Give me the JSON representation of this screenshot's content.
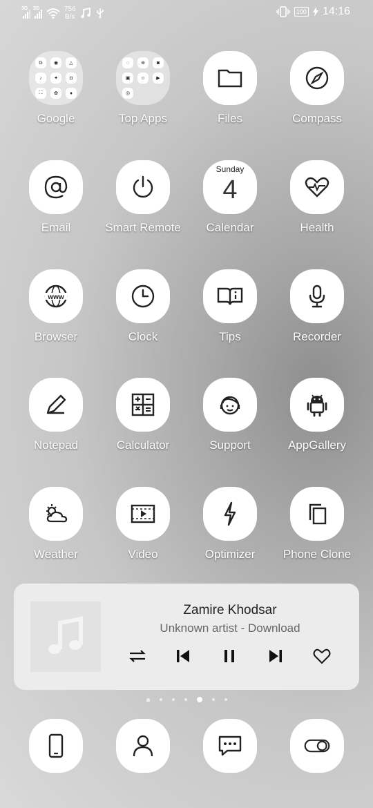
{
  "status_bar": {
    "net1": "3G",
    "net2": "3G",
    "speed_value": "756",
    "speed_unit": "B/s",
    "battery": "100",
    "time": "14:16",
    "icons": [
      "signal-icon",
      "signal-icon",
      "wifi-icon",
      "music-note-icon",
      "usb-icon",
      "vibrate-icon",
      "battery-icon",
      "charging-icon"
    ]
  },
  "apps": [
    {
      "label": "Google",
      "icon": "google-folder"
    },
    {
      "label": "Top Apps",
      "icon": "top-apps-folder"
    },
    {
      "label": "Files",
      "icon": "folder-icon"
    },
    {
      "label": "Compass",
      "icon": "compass-icon"
    },
    {
      "label": "Email",
      "icon": "at-sign-icon"
    },
    {
      "label": "Smart Remote",
      "icon": "power-icon"
    },
    {
      "label": "Calendar",
      "icon": "calendar-icon"
    },
    {
      "label": "Health",
      "icon": "heart-pulse-icon"
    },
    {
      "label": "Browser",
      "icon": "globe-www-icon"
    },
    {
      "label": "Clock",
      "icon": "clock-icon"
    },
    {
      "label": "Tips",
      "icon": "book-info-icon"
    },
    {
      "label": "Recorder",
      "icon": "microphone-icon"
    },
    {
      "label": "Notepad",
      "icon": "pen-icon"
    },
    {
      "label": "Calculator",
      "icon": "calculator-icon"
    },
    {
      "label": "Support",
      "icon": "headset-person-icon"
    },
    {
      "label": "AppGallery",
      "icon": "android-icon"
    },
    {
      "label": "Weather",
      "icon": "sun-cloud-icon"
    },
    {
      "label": "Video",
      "icon": "video-play-icon"
    },
    {
      "label": "Optimizer",
      "icon": "lightning-icon"
    },
    {
      "label": "Phone Clone",
      "icon": "copy-icon"
    }
  ],
  "calendar": {
    "day_name": "Sunday",
    "day_number": "4"
  },
  "music_widget": {
    "title": "Zamire Khodsar",
    "artist": "Unknown artist - Download",
    "controls": [
      "shuffle-icon",
      "previous-icon",
      "pause-icon",
      "next-icon",
      "heart-icon"
    ]
  },
  "page_indicator": {
    "count": 7,
    "active_index": 4
  },
  "dock": [
    {
      "name": "phone",
      "icon": "phone-icon"
    },
    {
      "name": "contacts",
      "icon": "person-icon"
    },
    {
      "name": "messages",
      "icon": "chat-bubble-icon"
    },
    {
      "name": "settings",
      "icon": "toggle-icon"
    }
  ]
}
